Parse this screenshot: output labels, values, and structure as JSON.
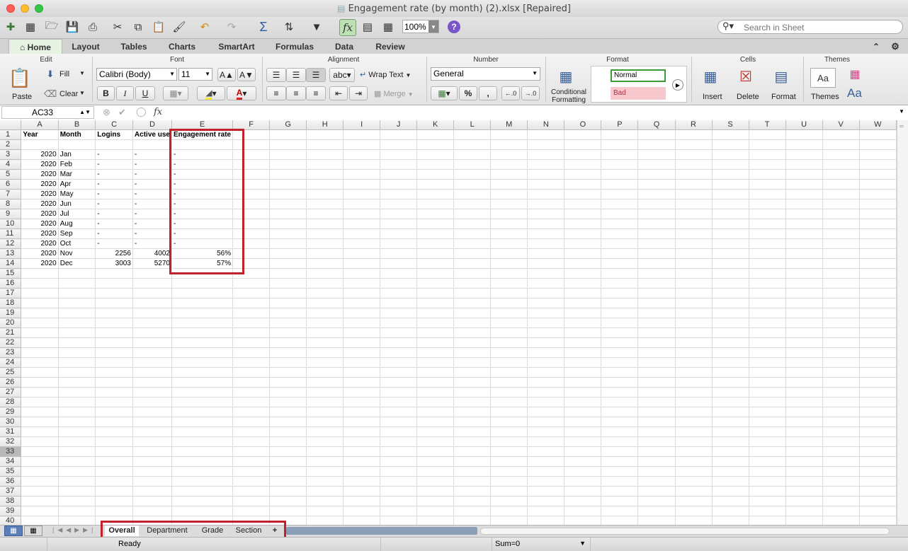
{
  "window": {
    "title": "Engagement rate (by month) (2).xlsx   [Repaired]"
  },
  "toolbar": {
    "zoom": "100%",
    "search_placeholder": "Search in Sheet",
    "help": "?"
  },
  "ribbon_tabs": [
    "Home",
    "Layout",
    "Tables",
    "Charts",
    "SmartArt",
    "Formulas",
    "Data",
    "Review"
  ],
  "ribbon": {
    "edit": {
      "title": "Edit",
      "paste": "Paste",
      "fill": "Fill",
      "clear": "Clear"
    },
    "font": {
      "title": "Font",
      "family": "Calibri (Body)",
      "size": "11",
      "bold": "B",
      "italic": "I",
      "underline": "U"
    },
    "alignment": {
      "title": "Alignment",
      "abc": "abc",
      "wrap": "Wrap Text",
      "merge": "Merge"
    },
    "number": {
      "title": "Number",
      "format": "General",
      "percent": "%",
      "comma": ","
    },
    "format": {
      "title": "Format",
      "conditional": "Conditional",
      "formatting": "Formatting",
      "normal": "Normal",
      "bad": "Bad"
    },
    "cells": {
      "title": "Cells",
      "insert": "Insert",
      "delete": "Delete",
      "format": "Format"
    },
    "themes": {
      "title": "Themes",
      "themes": "Themes",
      "aa": "Aa"
    }
  },
  "formula_bar": {
    "name_box": "AC33",
    "fx": "fx",
    "value": ""
  },
  "columns": [
    "A",
    "B",
    "C",
    "D",
    "E",
    "F",
    "G",
    "H",
    "I",
    "J",
    "K",
    "L",
    "M",
    "N",
    "O",
    "P",
    "Q",
    "R",
    "S",
    "T",
    "U",
    "V",
    "W"
  ],
  "selected_row": 33,
  "row_count": 40,
  "cells": [
    [
      "Year",
      "Month",
      "Logins",
      "Active use",
      "Engagement rate",
      ""
    ],
    [
      "",
      "",
      "",
      "",
      "",
      ""
    ],
    [
      "2020",
      "Jan",
      "-",
      "-",
      "-",
      ""
    ],
    [
      "2020",
      "Feb",
      "-",
      "-",
      "-",
      ""
    ],
    [
      "2020",
      "Mar",
      "-",
      "-",
      "-",
      ""
    ],
    [
      "2020",
      "Apr",
      "-",
      "-",
      "-",
      ""
    ],
    [
      "2020",
      "May",
      "-",
      "-",
      "-",
      ""
    ],
    [
      "2020",
      "Jun",
      "-",
      "-",
      "-",
      ""
    ],
    [
      "2020",
      "Jul",
      "-",
      "-",
      "-",
      ""
    ],
    [
      "2020",
      "Aug",
      "-",
      "-",
      "-",
      ""
    ],
    [
      "2020",
      "Sep",
      "-",
      "-",
      "-",
      ""
    ],
    [
      "2020",
      "Oct",
      "-",
      "-",
      "-",
      ""
    ],
    [
      "2020",
      "Nov",
      "2256",
      "4002",
      "56%",
      ""
    ],
    [
      "2020",
      "Dec",
      "3003",
      "5270",
      "57%",
      ""
    ]
  ],
  "sheet_tabs": [
    {
      "label": "Overall",
      "active": true
    },
    {
      "label": "Department",
      "active": false
    },
    {
      "label": "Grade",
      "active": false
    },
    {
      "label": "Section",
      "active": false
    }
  ],
  "add_sheet": "+",
  "status": {
    "ready": "Ready",
    "sum": "Sum=0"
  },
  "colors": {
    "highlight": "#c0232c",
    "normal_style": "#3a9a3a",
    "bad_bg": "#f7c9cf",
    "bad_text": "#b8293b",
    "selected_header": "#b9b9b9"
  }
}
